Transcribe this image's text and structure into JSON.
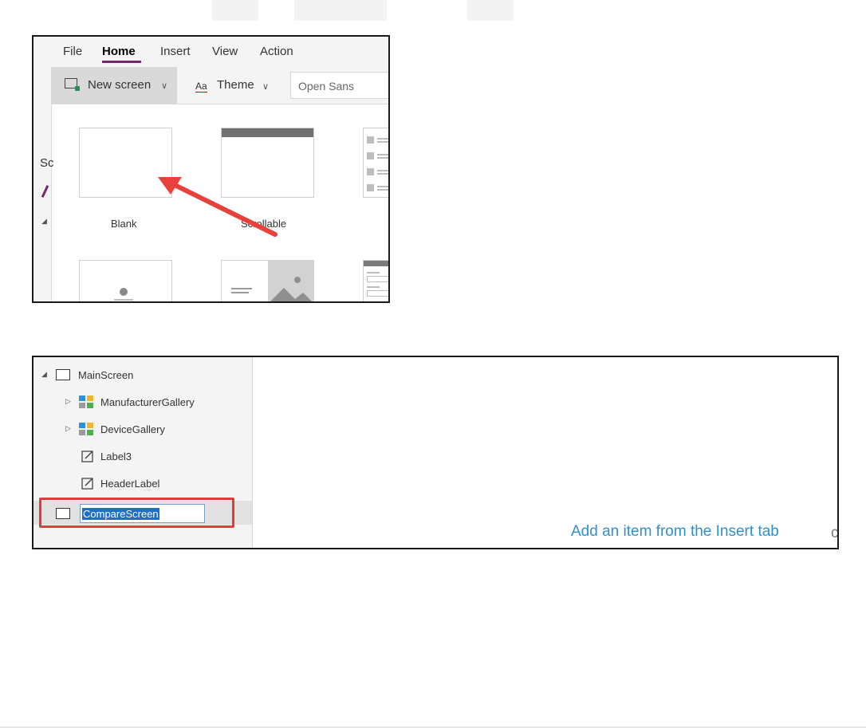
{
  "menu": {
    "items": [
      {
        "label": "File",
        "active": false
      },
      {
        "label": "Home",
        "active": true
      },
      {
        "label": "Insert",
        "active": false
      },
      {
        "label": "View",
        "active": false
      },
      {
        "label": "Action",
        "active": false
      }
    ],
    "accent_color": "#742774"
  },
  "toolbar": {
    "new_screen_label": "New screen",
    "theme_label": "Theme",
    "theme_icon_text": "Aa",
    "font_value": "Open Sans"
  },
  "left_strip": {
    "label": "Sc"
  },
  "layouts": {
    "items": [
      {
        "label": "Blank"
      },
      {
        "label": "Scrollable"
      }
    ]
  },
  "annotation": {
    "arrow_color": "#e8413c",
    "highlight_color": "#e03b3b"
  },
  "tree": {
    "items": [
      {
        "label": "MainScreen",
        "type": "screen",
        "expanded": true
      },
      {
        "label": "ManufacturerGallery",
        "type": "gallery",
        "expanded": false
      },
      {
        "label": "DeviceGallery",
        "type": "gallery",
        "expanded": false
      },
      {
        "label": "Label3",
        "type": "label"
      },
      {
        "label": "HeaderLabel",
        "type": "label"
      },
      {
        "label": "CompareScreen",
        "type": "screen",
        "selected": true,
        "editing": true
      }
    ]
  },
  "canvas": {
    "hint": "Add an item from the Insert tab",
    "hint_color": "#2d8fd5"
  }
}
